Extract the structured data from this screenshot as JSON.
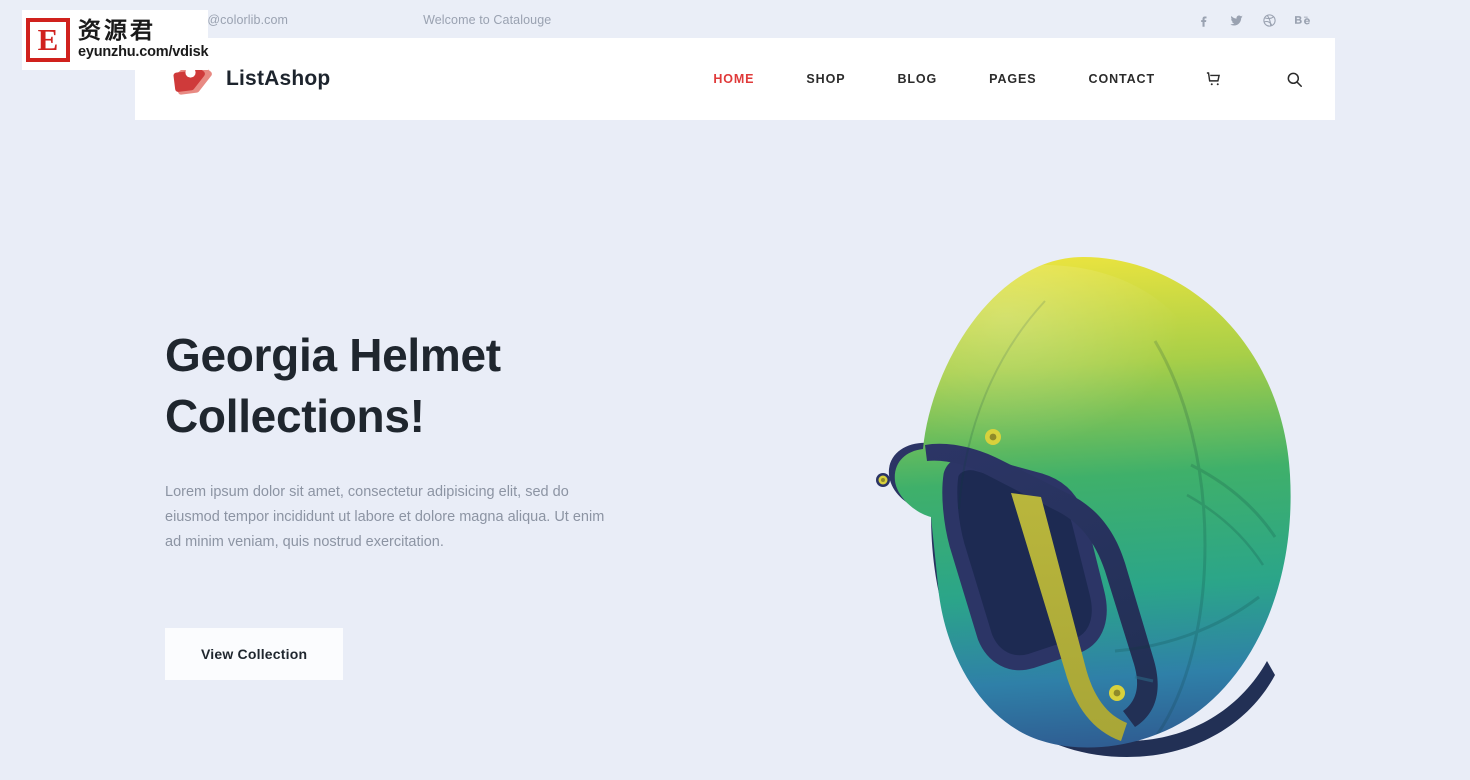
{
  "topbar": {
    "email": "support@colorlib.com",
    "welcome": "Welcome to Catalouge",
    "socials": [
      {
        "name": "facebook-icon",
        "label": "Facebook"
      },
      {
        "name": "twitter-icon",
        "label": "Twitter"
      },
      {
        "name": "dribbble-icon",
        "label": "Dribbble"
      },
      {
        "name": "behance-icon",
        "label": "Behance"
      }
    ]
  },
  "header": {
    "brand": "ListAshop",
    "logo_icon": "price-tag-icon",
    "nav": [
      {
        "label": "HOME",
        "active": true
      },
      {
        "label": "SHOP",
        "active": false
      },
      {
        "label": "BLOG",
        "active": false
      },
      {
        "label": "PAGES",
        "active": false
      },
      {
        "label": "CONTACT",
        "active": false
      }
    ],
    "cart_icon": "shopping-cart-icon",
    "search_icon": "search-icon"
  },
  "hero": {
    "title_line1": "Georgia Helmet",
    "title_line2": "Collections!",
    "description": "Lorem ipsum dolor sit amet, consectetur adipisicing elit, sed do eiusmod tempor incididunt ut labore et dolore magna aliqua. Ut enim ad minim veniam, quis nostrud exercitation.",
    "button_label": "View Collection",
    "image_alt": "open-face-helmet-image"
  },
  "watermark": {
    "badge_letter": "E",
    "chinese": "资源君",
    "url": "eyunzhu.com/vdisk"
  },
  "colors": {
    "page_background": "#e9edf7",
    "topbar_background": "#eaeef7",
    "header_background": "#ffffff",
    "accent_red": "#e03a3a",
    "heading": "#1f262e",
    "body_text": "#8c94a3",
    "muted_text": "#9aa2b1",
    "button_background": "#fbfcfe",
    "logo_red_front": "#cf3a3a",
    "logo_red_back": "#e4756d",
    "watermark_red": "#d0211d",
    "helmet_top": "#e8e243",
    "helmet_mid": "#2fae6e",
    "helmet_bottom": "#2f6f9e",
    "helmet_trim": "#2b3466",
    "helmet_strap": "#b5b33c"
  }
}
